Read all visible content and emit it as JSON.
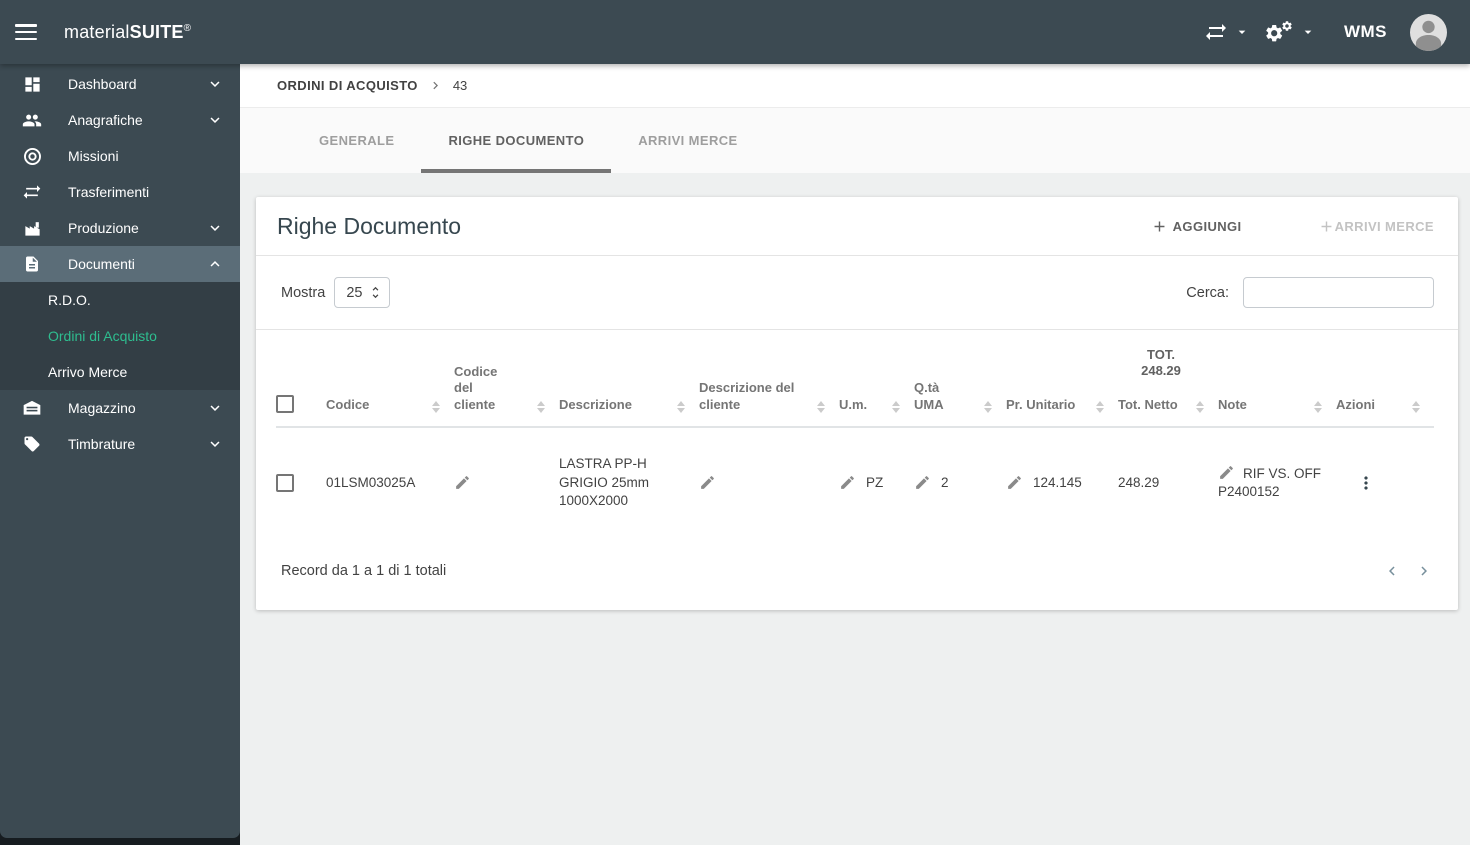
{
  "colors": {
    "topbar": "#3c4a52",
    "sidebar_active_bg": "#5b6d78",
    "submenu_bg": "#333e45",
    "accent_green": "#2ebd8f",
    "tab_underline": "#757575"
  },
  "topbar": {
    "brand_regular": "material",
    "brand_bold": "SUITE",
    "brand_mark": "®",
    "wms_label": "WMS"
  },
  "sidebar": {
    "items": [
      {
        "label": "Dashboard",
        "icon": "dashboard-icon",
        "chevron": "down"
      },
      {
        "label": "Anagrafiche",
        "icon": "people-icon",
        "chevron": "down"
      },
      {
        "label": "Missioni",
        "icon": "target-icon",
        "chevron": null
      },
      {
        "label": "Trasferimenti",
        "icon": "swap-icon",
        "chevron": null
      },
      {
        "label": "Produzione",
        "icon": "factory-icon",
        "chevron": "down"
      },
      {
        "label": "Documenti",
        "icon": "document-icon",
        "chevron": "up",
        "active": true
      },
      {
        "label": "Magazzino",
        "icon": "warehouse-icon",
        "chevron": "down"
      },
      {
        "label": "Timbrature",
        "icon": "tag-icon",
        "chevron": "down"
      }
    ],
    "submenu": [
      {
        "label": "R.D.O.",
        "active": false
      },
      {
        "label": "Ordini di Acquisto",
        "active": true
      },
      {
        "label": "Arrivo Merce",
        "active": false
      }
    ]
  },
  "breadcrumb": {
    "section": "ORDINI DI ACQUISTO",
    "id": "43"
  },
  "tabs": [
    {
      "label": "GENERALE",
      "active": false
    },
    {
      "label": "RIGHE DOCUMENTO",
      "active": true
    },
    {
      "label": "ARRIVI MERCE",
      "active": false
    }
  ],
  "card": {
    "title": "Righe Documento",
    "add_button": "AGGIUNGI",
    "arrivi_button": "ARRIVI MERCE",
    "show_label": "Mostra",
    "page_size": "25",
    "search_label": "Cerca:",
    "search_value": ""
  },
  "table": {
    "columns": [
      "Codice",
      "Codice del cliente",
      "Descrizione",
      "Descrizione del cliente",
      "U.m.",
      "Q.tà UMA",
      "Pr. Unitario",
      "Tot. Netto",
      "Note",
      "Azioni"
    ],
    "total_label": "TOT.",
    "total_value": "248.29",
    "rows": [
      {
        "codice": "01LSM03025A",
        "codice_cliente": "",
        "descrizione": "LASTRA PP-H GRIGIO 25mm 1000X2000",
        "descrizione_cliente": "",
        "um": "PZ",
        "qta_uma": "2",
        "pr_unitario": "124.145",
        "tot_netto": "248.29",
        "note": "RIF VS. OFF P2400152"
      }
    ]
  },
  "footer": {
    "records_text": "Record da 1 a 1 di 1 totali"
  }
}
